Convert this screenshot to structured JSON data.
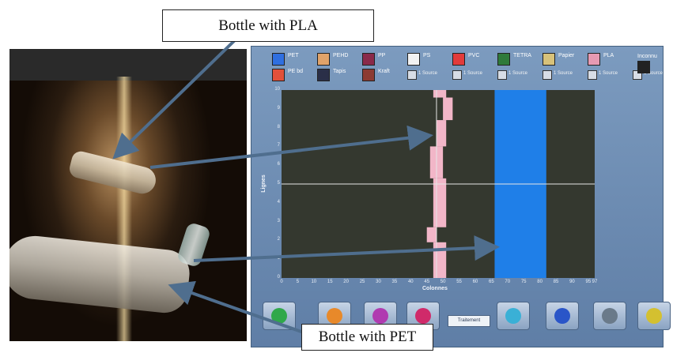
{
  "callouts": {
    "top": "Bottle with PLA",
    "bottom": "Bottle with PET"
  },
  "legend": {
    "row1": [
      {
        "label": "PET",
        "color": "#2f6fe0"
      },
      {
        "label": "PEHD",
        "color": "#e0a36a"
      },
      {
        "label": "PP",
        "color": "#8a2a4a"
      },
      {
        "label": "PS",
        "color": "#f2f2f2"
      },
      {
        "label": "PVC",
        "color": "#e23b3b"
      },
      {
        "label": "TETRA",
        "color": "#2f7a3a"
      },
      {
        "label": "Papier",
        "color": "#d8c27a"
      },
      {
        "label": "PLA",
        "color": "#e79ab2"
      }
    ],
    "row2": [
      {
        "label": "PE bd",
        "color": "#e2503a"
      },
      {
        "label": "Tapis",
        "color": "#2a2f48"
      },
      {
        "label": "Kraft",
        "color": "#8c3b32"
      }
    ],
    "mini_label": "1 Source",
    "extra_label": "Inconnu",
    "extra_color": "#222222"
  },
  "chart_data": {
    "type": "heatmap",
    "ylabel": "Lignes",
    "xlabel": "Colonnes",
    "x_ticks": [
      "0",
      "5",
      "10",
      "15",
      "20",
      "25",
      "30",
      "35",
      "40",
      "45",
      "50",
      "55",
      "60",
      "65",
      "70",
      "75",
      "80",
      "85",
      "90",
      "95",
      "97"
    ],
    "y_ticks": [
      "0",
      "1",
      "2",
      "3",
      "4",
      "5",
      "6",
      "7",
      "8",
      "9",
      "10"
    ],
    "xlim": [
      0,
      97
    ],
    "ylim": [
      0,
      10
    ],
    "regions": [
      {
        "material": "PET",
        "color": "#1f7fe8",
        "rows": [
          {
            "y0": 0,
            "y1": 10,
            "x0": 66,
            "x1": 82
          }
        ]
      },
      {
        "material": "PLA",
        "color": "#f2b6c8",
        "rows": [
          {
            "y0": 9.6,
            "y1": 10,
            "x0": 47,
            "x1": 51
          },
          {
            "y0": 8.4,
            "y1": 9.6,
            "x0": 50,
            "x1": 53
          },
          {
            "y0": 7.0,
            "y1": 8.4,
            "x0": 48,
            "x1": 51
          },
          {
            "y0": 5.3,
            "y1": 7.0,
            "x0": 46,
            "x1": 50
          },
          {
            "y0": 2.7,
            "y1": 5.3,
            "x0": 47,
            "x1": 51
          },
          {
            "y0": 1.9,
            "y1": 2.7,
            "x0": 45,
            "x1": 48
          },
          {
            "y0": 0.0,
            "y1": 1.9,
            "x0": 47,
            "x1": 51
          }
        ]
      }
    ],
    "crosshair": {
      "x": 48,
      "y": 5
    }
  },
  "toolbar": {
    "traitement_label": "Traitement",
    "buttons": [
      {
        "name": "recycle-button",
        "color": "#2fa84a"
      },
      {
        "name": "calibrate-button",
        "color": "#e8892a"
      },
      {
        "name": "camera-button",
        "color": "#b03ab0"
      },
      {
        "name": "record-button",
        "color": "#d02a6a"
      },
      {
        "name": "filter-button",
        "color": "#3ab0d6"
      },
      {
        "name": "chart-button",
        "color": "#2a55c8"
      },
      {
        "name": "save-button",
        "color": "#6a7a8a"
      },
      {
        "name": "delete-button",
        "color": "#d4c030"
      }
    ]
  }
}
